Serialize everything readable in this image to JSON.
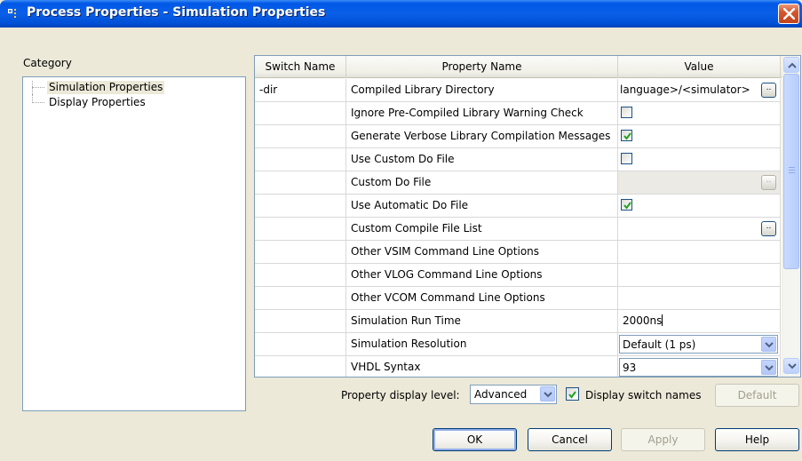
{
  "window": {
    "title": "Process Properties - Simulation Properties",
    "colors": {
      "titlebar": "#0058e6",
      "close": "#d5562f",
      "dialog_bg": "#ece9d8",
      "check": "#21a121"
    }
  },
  "category": {
    "label": "Category",
    "items": [
      {
        "label": "Simulation Properties",
        "selected": true
      },
      {
        "label": "Display Properties",
        "selected": false
      }
    ]
  },
  "grid": {
    "columns": [
      "Switch Name",
      "Property Name",
      "Value"
    ],
    "rows": [
      {
        "switch": "-dir",
        "property": "Compiled Library Directory",
        "value_text": "language>/<simulator>",
        "value_type": "text-browse"
      },
      {
        "switch": "",
        "property": "Ignore Pre-Compiled Library Warning Check",
        "value_type": "checkbox",
        "checked": false
      },
      {
        "switch": "",
        "property": "Generate Verbose Library Compilation Messages",
        "value_type": "checkbox",
        "checked": true
      },
      {
        "switch": "",
        "property": "Use Custom Do File",
        "value_type": "checkbox",
        "checked": false
      },
      {
        "switch": "",
        "property": "Custom Do File",
        "value_type": "browse-disabled"
      },
      {
        "switch": "",
        "property": "Use Automatic Do File",
        "value_type": "checkbox",
        "checked": true
      },
      {
        "switch": "",
        "property": "Custom Compile File List",
        "value_type": "browse"
      },
      {
        "switch": "",
        "property": "Other VSIM Command Line Options",
        "value_type": "text",
        "value_text": ""
      },
      {
        "switch": "",
        "property": "Other VLOG Command Line Options",
        "value_type": "text",
        "value_text": ""
      },
      {
        "switch": "",
        "property": "Other VCOM Command Line Options",
        "value_type": "text",
        "value_text": ""
      },
      {
        "switch": "",
        "property": "Simulation Run Time",
        "value_text": "2000ns",
        "value_type": "text-edit"
      },
      {
        "switch": "",
        "property": "Simulation Resolution",
        "value_text": "Default (1 ps)",
        "value_type": "combo"
      },
      {
        "switch": "",
        "property": "VHDL Syntax",
        "value_text": "93",
        "value_type": "combo"
      }
    ],
    "browse_label": ".."
  },
  "footer": {
    "display_level_label": "Property display level:",
    "display_level_value": "Advanced",
    "display_switch_label": "Display switch names",
    "display_switch_checked": true,
    "default_button": "Default"
  },
  "buttons": {
    "ok": "OK",
    "cancel": "Cancel",
    "apply": "Apply",
    "help": "Help"
  }
}
